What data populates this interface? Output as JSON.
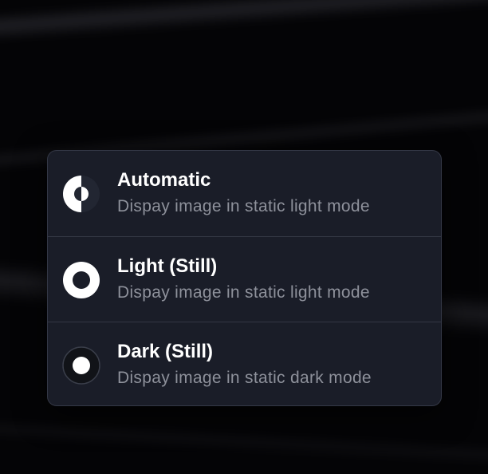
{
  "appearance_menu": {
    "options": [
      {
        "title": "Automatic",
        "subtitle": "Dispay image in static light mode",
        "icon": "half-circle-icon"
      },
      {
        "title": "Light (Still)",
        "subtitle": "Dispay image in static light mode",
        "icon": "light-mode-icon"
      },
      {
        "title": "Dark (Still)",
        "subtitle": "Dispay image in static dark mode",
        "icon": "dark-mode-icon"
      }
    ]
  },
  "colors": {
    "menu_background": "#1a1d28",
    "title_text": "#ffffff",
    "subtitle_text": "#8e919b",
    "divider": "#333744"
  }
}
